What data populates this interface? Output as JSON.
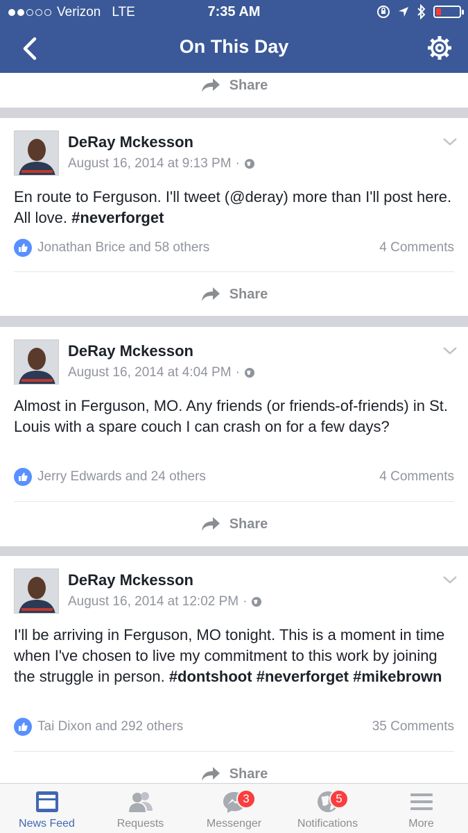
{
  "status": {
    "carrier": "Verizon",
    "network": "LTE",
    "time": "7:35 AM"
  },
  "nav": {
    "title": "On This Day"
  },
  "share_label": "Share",
  "posts": [
    {
      "author": "DeRay Mckesson",
      "timestamp": "August 16, 2014 at 9:13 PM",
      "text_plain": "En route to Ferguson. I'll tweet (@deray) more than I'll post here. All love. ",
      "hashtags": [
        "#neverforget"
      ],
      "likes_text": "Jonathan Brice and 58 others",
      "comments_text": "4 Comments"
    },
    {
      "author": "DeRay Mckesson",
      "timestamp": "August 16, 2014 at 4:04 PM",
      "text_plain": "Almost in Ferguson, MO. Any friends (or friends-of-friends) in St. Louis with a spare couch I can crash on for a few days?",
      "hashtags": [],
      "likes_text": "Jerry Edwards and 24 others",
      "comments_text": "4 Comments"
    },
    {
      "author": "DeRay Mckesson",
      "timestamp": "August 16, 2014 at 12:02 PM",
      "text_plain": "I'll be arriving in Ferguson, MO tonight. This is a moment in time when I've chosen to live my commitment to this work by joining the struggle in person. ",
      "hashtags": [
        "#dontshoot",
        "#neverforget",
        "#mikebrown"
      ],
      "likes_text": "Tai Dixon and 292 others",
      "comments_text": "35 Comments"
    }
  ],
  "tabs": [
    {
      "label": "News Feed",
      "icon": "news-feed-icon",
      "active": true
    },
    {
      "label": "Requests",
      "icon": "friend-requests-icon"
    },
    {
      "label": "Messenger",
      "icon": "messenger-icon",
      "badge": "3"
    },
    {
      "label": "Notifications",
      "icon": "globe-icon",
      "badge": "5"
    },
    {
      "label": "More",
      "icon": "menu-icon"
    }
  ],
  "colors": {
    "brand": "#3b5998",
    "active_tab": "#4267b2",
    "badge": "#fa3e3e",
    "like": "#5890ff"
  }
}
